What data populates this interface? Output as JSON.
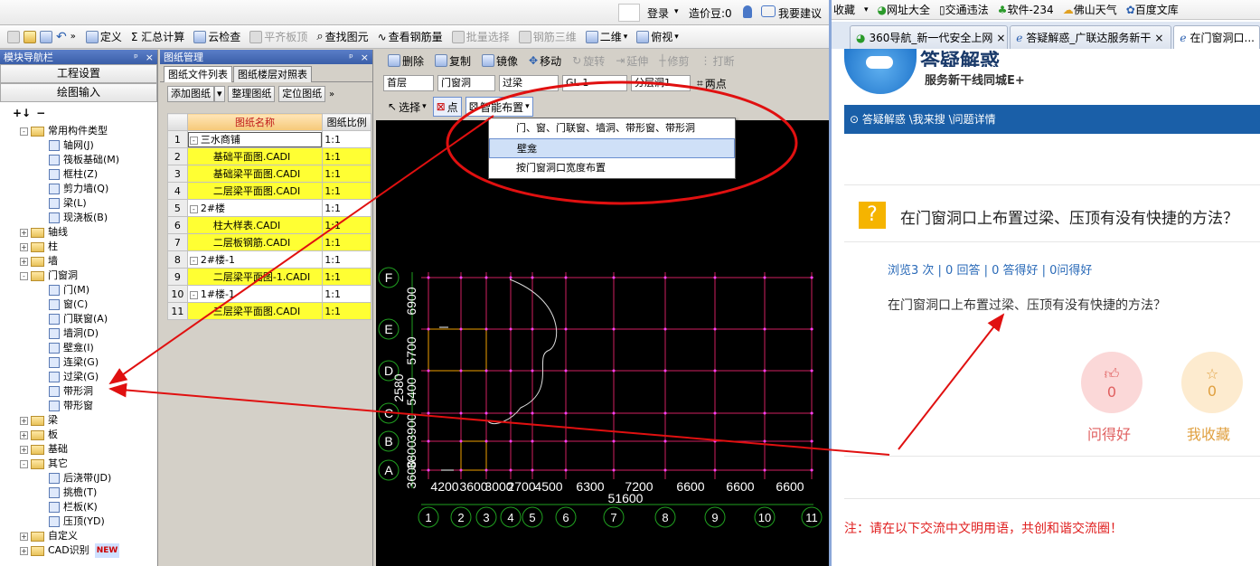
{
  "app": {
    "login": "登录",
    "price_beans": "造价豆:0",
    "suggestion": "我要建议"
  },
  "toolbar1": [
    "定义",
    "Σ 汇总计算",
    "云检查",
    "平齐板顶",
    "查找图元",
    "查看钢筋量",
    "批量选择",
    "钢筋三维",
    "二维",
    "俯视"
  ],
  "nav": {
    "title": "模块导航栏",
    "btn_settings": "工程设置",
    "btn_drawing": "绘图输入",
    "tree": [
      {
        "level": 0,
        "pm": "-",
        "folder": true,
        "label": "常用构件类型"
      },
      {
        "level": 1,
        "label": "轴网(J)"
      },
      {
        "level": 1,
        "label": "筏板基础(M)"
      },
      {
        "level": 1,
        "label": "框柱(Z)"
      },
      {
        "level": 1,
        "label": "剪力墙(Q)"
      },
      {
        "level": 1,
        "label": "梁(L)"
      },
      {
        "level": 1,
        "label": "现浇板(B)"
      },
      {
        "level": 0,
        "pm": "+",
        "folder": true,
        "label": "轴线"
      },
      {
        "level": 0,
        "pm": "+",
        "folder": true,
        "label": "柱"
      },
      {
        "level": 0,
        "pm": "+",
        "folder": true,
        "label": "墙"
      },
      {
        "level": 0,
        "pm": "-",
        "folder": true,
        "label": "门窗洞"
      },
      {
        "level": 1,
        "label": "门(M)"
      },
      {
        "level": 1,
        "label": "窗(C)"
      },
      {
        "level": 1,
        "label": "门联窗(A)"
      },
      {
        "level": 1,
        "label": "墙洞(D)"
      },
      {
        "level": 1,
        "label": "壁龛(I)"
      },
      {
        "level": 1,
        "label": "连梁(G)"
      },
      {
        "level": 1,
        "label": "过梁(G)"
      },
      {
        "level": 1,
        "label": "带形洞"
      },
      {
        "level": 1,
        "label": "带形窗"
      },
      {
        "level": 0,
        "pm": "+",
        "folder": true,
        "label": "梁"
      },
      {
        "level": 0,
        "pm": "+",
        "folder": true,
        "label": "板"
      },
      {
        "level": 0,
        "pm": "+",
        "folder": true,
        "label": "基础"
      },
      {
        "level": 0,
        "pm": "-",
        "folder": true,
        "label": "其它"
      },
      {
        "level": 1,
        "label": "后浇带(JD)"
      },
      {
        "level": 1,
        "label": "挑檐(T)"
      },
      {
        "level": 1,
        "label": "栏板(K)"
      },
      {
        "level": 1,
        "label": "压顶(YD)"
      },
      {
        "level": 0,
        "pm": "+",
        "folder": true,
        "label": "自定义"
      },
      {
        "level": 0,
        "pm": "+",
        "folder": true,
        "label": "CAD识别",
        "badge": "NEW"
      }
    ]
  },
  "drawing": {
    "title": "图纸管理",
    "tabs": [
      "图纸文件列表",
      "图纸楼层对照表"
    ],
    "buttons": [
      "添加图纸",
      "整理图纸",
      "定位图纸"
    ],
    "col_name": "图纸名称",
    "col_scale": "图纸比例",
    "rows": [
      {
        "i": "1",
        "pm": "-",
        "name": "三水商铺",
        "scale": "1:1",
        "hl": false
      },
      {
        "i": "2",
        "name": "基础平面图.CADI",
        "scale": "1:1",
        "hl": true
      },
      {
        "i": "3",
        "name": "基础梁平面图.CADI",
        "scale": "1:1",
        "hl": true
      },
      {
        "i": "4",
        "name": "二层梁平面图.CADI",
        "scale": "1:1",
        "hl": true
      },
      {
        "i": "5",
        "pm": "-",
        "name": "2#楼",
        "scale": "1:1",
        "hl": false
      },
      {
        "i": "6",
        "name": "柱大样表.CADI",
        "scale": "1:1",
        "hl": true
      },
      {
        "i": "7",
        "name": "二层板钢筋.CADI",
        "scale": "1:1",
        "hl": true
      },
      {
        "i": "8",
        "pm": "-",
        "name": "2#楼-1",
        "scale": "1:1",
        "hl": false
      },
      {
        "i": "9",
        "name": "二层梁平面图-1.CADI",
        "scale": "1:1",
        "hl": true
      },
      {
        "i": "10",
        "pm": "-",
        "name": "1#楼-1",
        "scale": "1:1",
        "hl": false
      },
      {
        "i": "11",
        "name": "三层梁平面图.CADI",
        "scale": "1:1",
        "hl": true
      }
    ]
  },
  "cad": {
    "tools": [
      "删除",
      "复制",
      "镜像",
      "移动",
      "旋转",
      "延伸",
      "修剪",
      "打断"
    ],
    "floor": "首层",
    "category": "门窗洞",
    "type": "过梁",
    "component": "GL-1",
    "layer": "分层洞1",
    "two_points": "两点",
    "select": "选择",
    "smart_layout": "智能布置",
    "menu": [
      "门、窗、门联窗、墙洞、带形窗、带形洞",
      "壁龛",
      "按门窗洞口宽度布置"
    ],
    "row_labels": [
      "F",
      "E",
      "D",
      "C",
      "B",
      "A"
    ],
    "col_labels": [
      "1",
      "2",
      "3",
      "4",
      "5",
      "6",
      "7",
      "8",
      "9",
      "10",
      "11"
    ],
    "dim_top": [
      "4200",
      "3600",
      "3000",
      "2700",
      "4500",
      "6300",
      "7200",
      "6600",
      "6600",
      "6600"
    ],
    "dim_total": "51600",
    "dim_side": [
      "6900",
      "5700",
      "5400",
      "3900",
      "3800",
      "3600",
      "2580"
    ]
  },
  "browser": {
    "fav": [
      "收藏",
      "网址大全",
      "交通违法",
      "软件-234",
      "佛山天气",
      "百度文库"
    ],
    "tabs": [
      "360导航_新一代安全上网",
      "答疑解惑_广联达服务新干",
      "在门窗洞口..."
    ],
    "brand_title": "答疑解惑",
    "brand_sub": "服务新干线同城E+",
    "breadcrumb": "答疑解惑 \\我来搜 \\问题详情",
    "question": "在门窗洞口上布置过梁、压顶有没有快捷的方法？",
    "stats": "浏览3 次 | 0 回答 | 0 答得好 | 0问得好",
    "body": "在门窗洞口上布置过梁、压顶有没有快捷的方法？",
    "good_count": "0",
    "good_label": "问得好",
    "fav_count": "0",
    "fav_label": "我收藏",
    "notice": "注：请在以下交流中文明用语，共创和谐交流圈！"
  }
}
